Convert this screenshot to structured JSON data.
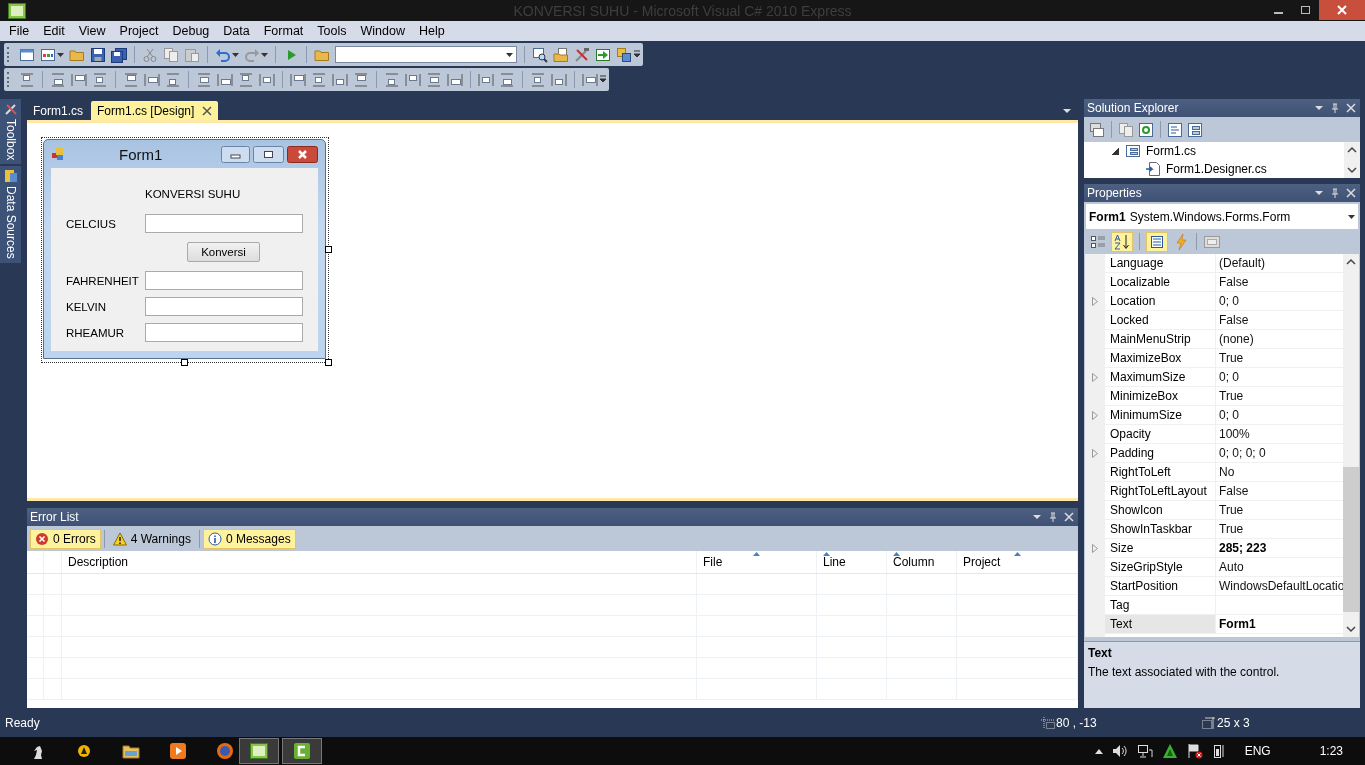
{
  "window": {
    "title": "KONVERSI SUHU - Microsoft Visual C# 2010 Express"
  },
  "menu": [
    "File",
    "Edit",
    "View",
    "Project",
    "Debug",
    "Data",
    "Format",
    "Tools",
    "Window",
    "Help"
  ],
  "side_tabs": [
    {
      "label": "Toolbox"
    },
    {
      "label": "Data Sources"
    }
  ],
  "document_tabs": [
    {
      "label": "Form1.cs",
      "selected": false
    },
    {
      "label": "Form1.cs [Design]",
      "selected": true
    }
  ],
  "form": {
    "title": "Form1",
    "rows": [
      {
        "kind": "heading",
        "text": "KONVERSI SUHU"
      },
      {
        "kind": "field",
        "label": "CELCIUS"
      },
      {
        "kind": "button",
        "text": "Konversi"
      },
      {
        "kind": "field",
        "label": "FAHRENHEIT"
      },
      {
        "kind": "field",
        "label": "KELVIN"
      },
      {
        "kind": "field",
        "label": "RHEAMUR"
      }
    ]
  },
  "error_list": {
    "title": "Error List",
    "filters": [
      {
        "kind": "error",
        "label": "0 Errors",
        "selected": true
      },
      {
        "kind": "warning",
        "label": "4 Warnings",
        "selected": false
      },
      {
        "kind": "info",
        "label": "0 Messages",
        "selected": true
      }
    ],
    "columns": [
      "Description",
      "File",
      "Line",
      "Column",
      "Project"
    ]
  },
  "solution_explorer": {
    "title": "Solution Explorer",
    "tree": [
      {
        "label": "Form1.cs",
        "expanded": true,
        "children": [
          {
            "label": "Form1.Designer.cs"
          }
        ]
      }
    ]
  },
  "properties": {
    "title": "Properties",
    "object_name": "Form1",
    "object_type": "System.Windows.Forms.Form",
    "rows": [
      {
        "name": "Language",
        "value": "(Default)",
        "modified": false,
        "selected": false
      },
      {
        "name": "Localizable",
        "value": "False",
        "modified": false,
        "selected": false
      },
      {
        "name": "Location",
        "value": "0; 0",
        "expandable": true,
        "modified": false,
        "selected": false
      },
      {
        "name": "Locked",
        "value": "False",
        "modified": false,
        "selected": false
      },
      {
        "name": "MainMenuStrip",
        "value": "(none)",
        "modified": false,
        "selected": false
      },
      {
        "name": "MaximizeBox",
        "value": "True",
        "modified": false,
        "selected": false
      },
      {
        "name": "MaximumSize",
        "value": "0; 0",
        "expandable": true,
        "modified": false,
        "selected": false
      },
      {
        "name": "MinimizeBox",
        "value": "True",
        "modified": false,
        "selected": false
      },
      {
        "name": "MinimumSize",
        "value": "0; 0",
        "expandable": true,
        "modified": false,
        "selected": false
      },
      {
        "name": "Opacity",
        "value": "100%",
        "modified": false,
        "selected": false
      },
      {
        "name": "Padding",
        "value": "0; 0; 0; 0",
        "expandable": true,
        "modified": false,
        "selected": false
      },
      {
        "name": "RightToLeft",
        "value": "No",
        "modified": false,
        "selected": false
      },
      {
        "name": "RightToLeftLayout",
        "value": "False",
        "modified": false,
        "selected": false
      },
      {
        "name": "ShowIcon",
        "value": "True",
        "modified": false,
        "selected": false
      },
      {
        "name": "ShowInTaskbar",
        "value": "True",
        "modified": false,
        "selected": false
      },
      {
        "name": "Size",
        "value": "285; 223",
        "expandable": true,
        "modified": true,
        "selected": false
      },
      {
        "name": "SizeGripStyle",
        "value": "Auto",
        "modified": false,
        "selected": false
      },
      {
        "name": "StartPosition",
        "value": "WindowsDefaultLocatio",
        "modified": false,
        "selected": false
      },
      {
        "name": "Tag",
        "selected": false
      },
      {
        "name": "Text",
        "value": "Form1",
        "modified": true,
        "selected": true
      }
    ],
    "description_title": "Text",
    "description": "The text associated with the control."
  },
  "status_bar": {
    "text": "Ready",
    "position": "80 , -13",
    "size": "25 x 3"
  },
  "taskbar": {
    "language": "ENG",
    "time": "1:23"
  }
}
